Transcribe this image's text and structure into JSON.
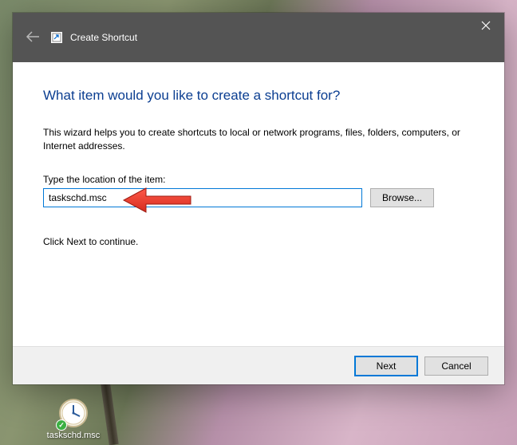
{
  "header": {
    "title": "Create Shortcut"
  },
  "body": {
    "heading": "What item would you like to create a shortcut for?",
    "description": "This wizard helps you to create shortcuts to local or network programs, files, folders, computers, or Internet addresses.",
    "field_label": "Type the location of the item:",
    "location_value": "taskschd.msc",
    "browse_label": "Browse...",
    "instruction": "Click Next to continue."
  },
  "footer": {
    "next_label": "Next",
    "cancel_label": "Cancel"
  },
  "desktop": {
    "shortcut_name": "taskschd.msc"
  }
}
